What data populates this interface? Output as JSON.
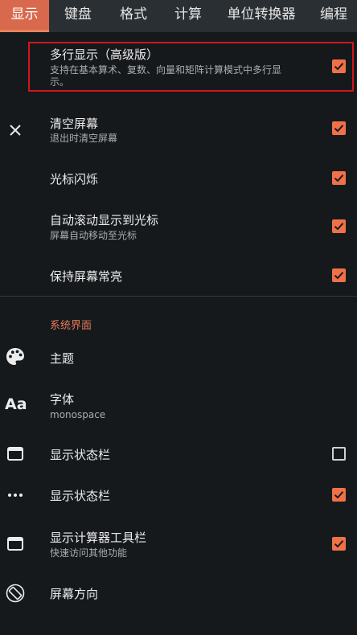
{
  "tabs": [
    {
      "label": "显示",
      "active": true
    },
    {
      "label": "键盘",
      "active": false
    },
    {
      "label": "格式",
      "active": false
    },
    {
      "label": "计算",
      "active": false
    },
    {
      "label": "单位转换器",
      "active": false
    },
    {
      "label": "编程",
      "active": false
    }
  ],
  "display_settings": [
    {
      "title": "多行显示（高级版）",
      "subtitle_line1": "支持在基本算术、复数、向量和矩阵计算模式中多行显",
      "subtitle_line2": "示。",
      "checked": true,
      "highlighted": true
    },
    {
      "title": "清空屏幕",
      "subtitle": "退出时清空屏幕",
      "icon": "close-icon",
      "checked": true
    },
    {
      "title": "光标闪烁",
      "checked": true
    },
    {
      "title": "自动滚动显示到光标",
      "subtitle": "屏幕自动移动至光标",
      "checked": true
    },
    {
      "title": "保持屏幕常亮",
      "checked": true
    }
  ],
  "system_section": {
    "header": "系统界面",
    "accent_color": "#e8785a",
    "items": [
      {
        "title": "主题",
        "icon": "palette-icon"
      },
      {
        "title": "字体",
        "subtitle": "monospace",
        "icon": "font-icon",
        "icon_text": "Aa"
      },
      {
        "title": "显示状态栏",
        "icon": "window-icon",
        "checked": false
      },
      {
        "title": "显示状态栏",
        "icon": "more-horizontal-icon",
        "checked": true
      },
      {
        "title": "显示计算器工具栏",
        "subtitle": "快速访问其他功能",
        "icon": "window-icon",
        "checked": true
      },
      {
        "title": "屏幕方向",
        "icon": "screen-rotation-icon"
      }
    ]
  },
  "colors": {
    "background": "#16191c",
    "tab_bar": "#2a2f33",
    "active_tab": "#d9694c",
    "checkbox": "#ef7148",
    "highlight_border": "#d0161c"
  }
}
